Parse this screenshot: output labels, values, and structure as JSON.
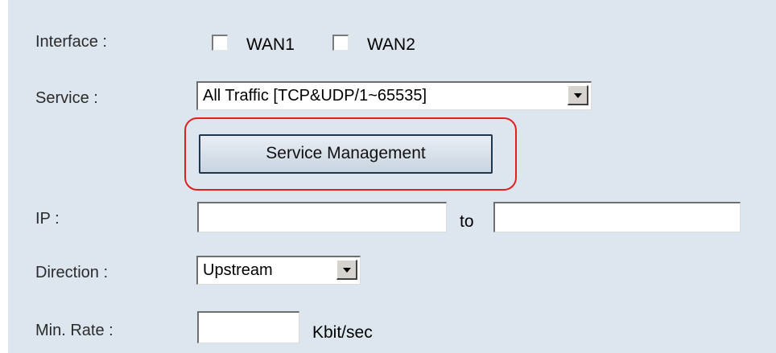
{
  "form": {
    "interface": {
      "label": "Interface :",
      "options": [
        {
          "label": "WAN1",
          "checked": false
        },
        {
          "label": "WAN2",
          "checked": false
        }
      ]
    },
    "service": {
      "label": "Service :",
      "selected": "All Traffic [TCP&UDP/1~65535]",
      "button_label": "Service Management"
    },
    "ip": {
      "label": "IP :",
      "from_value": "",
      "to_label": "to",
      "to_value": ""
    },
    "direction": {
      "label": "Direction :",
      "selected": "Upstream"
    },
    "min_rate": {
      "label": "Min. Rate :",
      "value": "",
      "unit": "Kbit/sec"
    }
  },
  "annotation": {
    "highlight_color": "#e02020"
  }
}
